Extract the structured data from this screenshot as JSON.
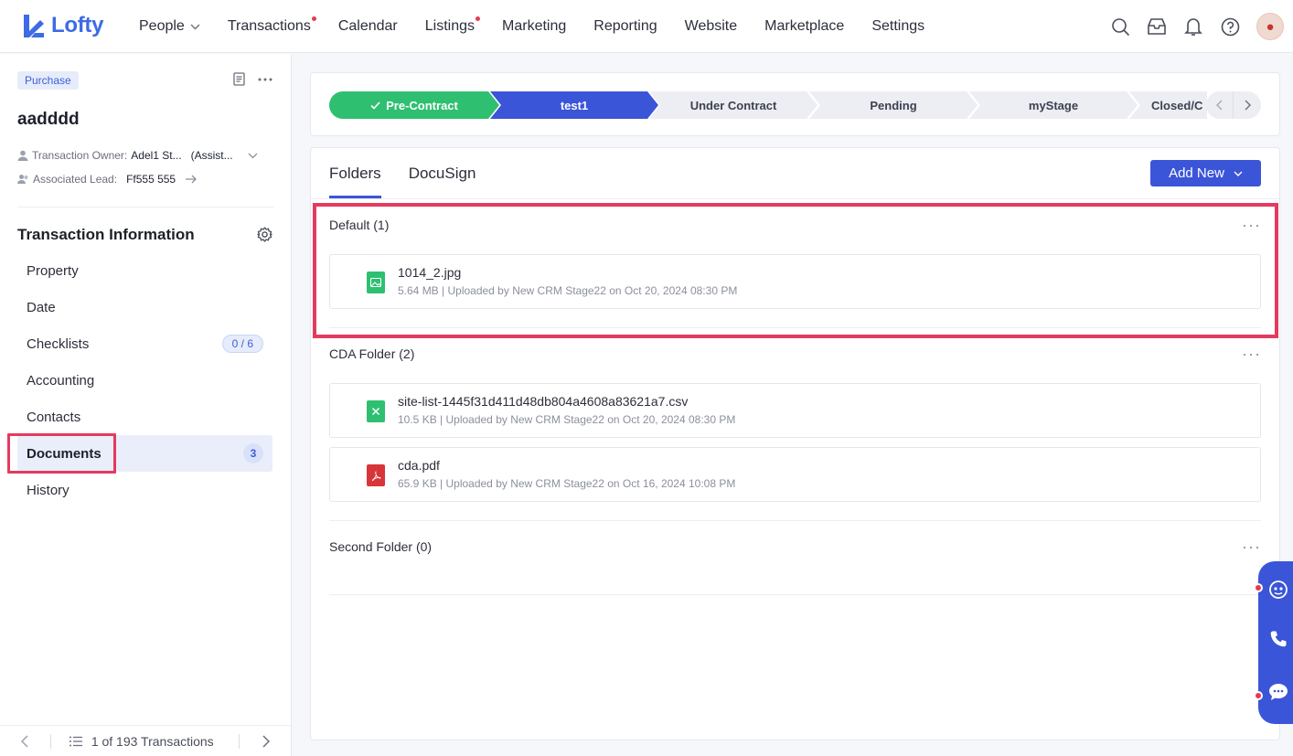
{
  "app": {
    "brand": "Lofty",
    "accent": "#3b55d8"
  },
  "nav": {
    "items": [
      {
        "label": "People",
        "dropdown": true,
        "dot": false
      },
      {
        "label": "Transactions",
        "dropdown": false,
        "dot": true
      },
      {
        "label": "Calendar",
        "dropdown": false,
        "dot": false
      },
      {
        "label": "Listings",
        "dropdown": false,
        "dot": true
      },
      {
        "label": "Marketing",
        "dropdown": false,
        "dot": false
      },
      {
        "label": "Reporting",
        "dropdown": false,
        "dot": false
      },
      {
        "label": "Website",
        "dropdown": false,
        "dot": false
      },
      {
        "label": "Marketplace",
        "dropdown": false,
        "dot": false
      },
      {
        "label": "Settings",
        "dropdown": false,
        "dot": false
      }
    ],
    "right_icons": [
      "search-icon",
      "inbox-icon",
      "bell-icon",
      "help-icon",
      "avatar"
    ]
  },
  "transaction": {
    "type_tag": "Purchase",
    "name": "aadddd",
    "owner_label": "Transaction Owner:",
    "owner_value": "Adel1 St...",
    "owner_role": "(Assist...",
    "lead_label": "Associated Lead:",
    "lead_value": "Ff555 555"
  },
  "info": {
    "title": "Transaction Information",
    "menu": [
      {
        "label": "Property",
        "badge": null
      },
      {
        "label": "Date",
        "badge": null
      },
      {
        "label": "Checklists",
        "badge": "0 / 6"
      },
      {
        "label": "Accounting",
        "badge": null
      },
      {
        "label": "Contacts",
        "badge": null
      },
      {
        "label": "Documents",
        "badge": "3"
      },
      {
        "label": "History",
        "badge": null
      }
    ]
  },
  "footer": {
    "pager_text": "1 of 193 Transactions"
  },
  "stages": [
    {
      "label": "Pre-Contract",
      "state": "done"
    },
    {
      "label": "test1",
      "state": "current"
    },
    {
      "label": "Under Contract",
      "state": "todo"
    },
    {
      "label": "Pending",
      "state": "todo"
    },
    {
      "label": "myStage",
      "state": "todo"
    },
    {
      "label": "Closed/C",
      "state": "todo"
    }
  ],
  "documents": {
    "tabs": [
      "Folders",
      "DocuSign"
    ],
    "add_new_label": "Add New",
    "folders": [
      {
        "title": "Default (1)",
        "files": [
          {
            "name": "1014_2.jpg",
            "meta": "5.64 MB | Uploaded by New CRM Stage22 on Oct 20, 2024 08:30 PM",
            "kind": "image"
          }
        ]
      },
      {
        "title": "CDA Folder (2)",
        "files": [
          {
            "name": "site-list-1445f31d411d48db804a4608a83621a7.csv",
            "meta": "10.5 KB | Uploaded by New CRM Stage22 on Oct 20, 2024 08:30 PM",
            "kind": "csv"
          },
          {
            "name": "cda.pdf",
            "meta": "65.9 KB | Uploaded by New CRM Stage22 on Oct 16, 2024 10:08 PM",
            "kind": "pdf"
          }
        ]
      },
      {
        "title": "Second Folder (0)",
        "files": []
      }
    ]
  }
}
